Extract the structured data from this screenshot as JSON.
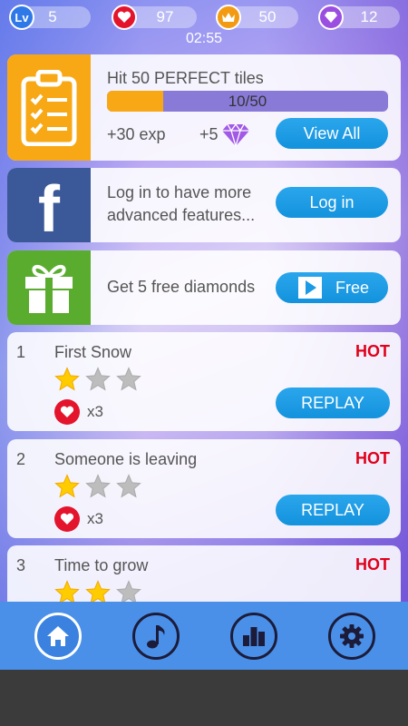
{
  "stats": {
    "level_label": "Lv",
    "level": "5",
    "lives": "97",
    "crowns": "50",
    "diamonds": "12"
  },
  "timer": "02:55",
  "quest": {
    "title": "Hit 50 PERFECT tiles",
    "progress_text": "10/50",
    "progress": 0.2,
    "reward_exp": "+30 exp",
    "reward_diamonds": "+5",
    "button": "View All"
  },
  "facebook": {
    "icon_letter": "f",
    "text_line1": "Log in to have more",
    "text_line2": "advanced features...",
    "button": "Log in"
  },
  "gift": {
    "text": "Get 5 free diamonds",
    "button": "Free"
  },
  "songs": [
    {
      "num": "1",
      "title": "First Snow",
      "tag": "HOT",
      "stars": 1,
      "lives": "x3",
      "button": "REPLAY"
    },
    {
      "num": "2",
      "title": "Someone is leaving",
      "tag": "HOT",
      "stars": 1,
      "lives": "x3",
      "button": "REPLAY"
    },
    {
      "num": "3",
      "title": "Time to grow",
      "tag": "HOT",
      "stars": 2,
      "lives": "",
      "button": ""
    }
  ],
  "nav": [
    "home-icon",
    "music-note-icon",
    "leaderboard-icon",
    "settings-gear-icon"
  ],
  "colors": {
    "accent_blue": "#1b9be6",
    "hot_red": "#e0001b",
    "quest_orange": "#f7a814",
    "facebook_blue": "#3b5998",
    "gift_green": "#5aac2e",
    "navbar": "#4a90e9"
  }
}
